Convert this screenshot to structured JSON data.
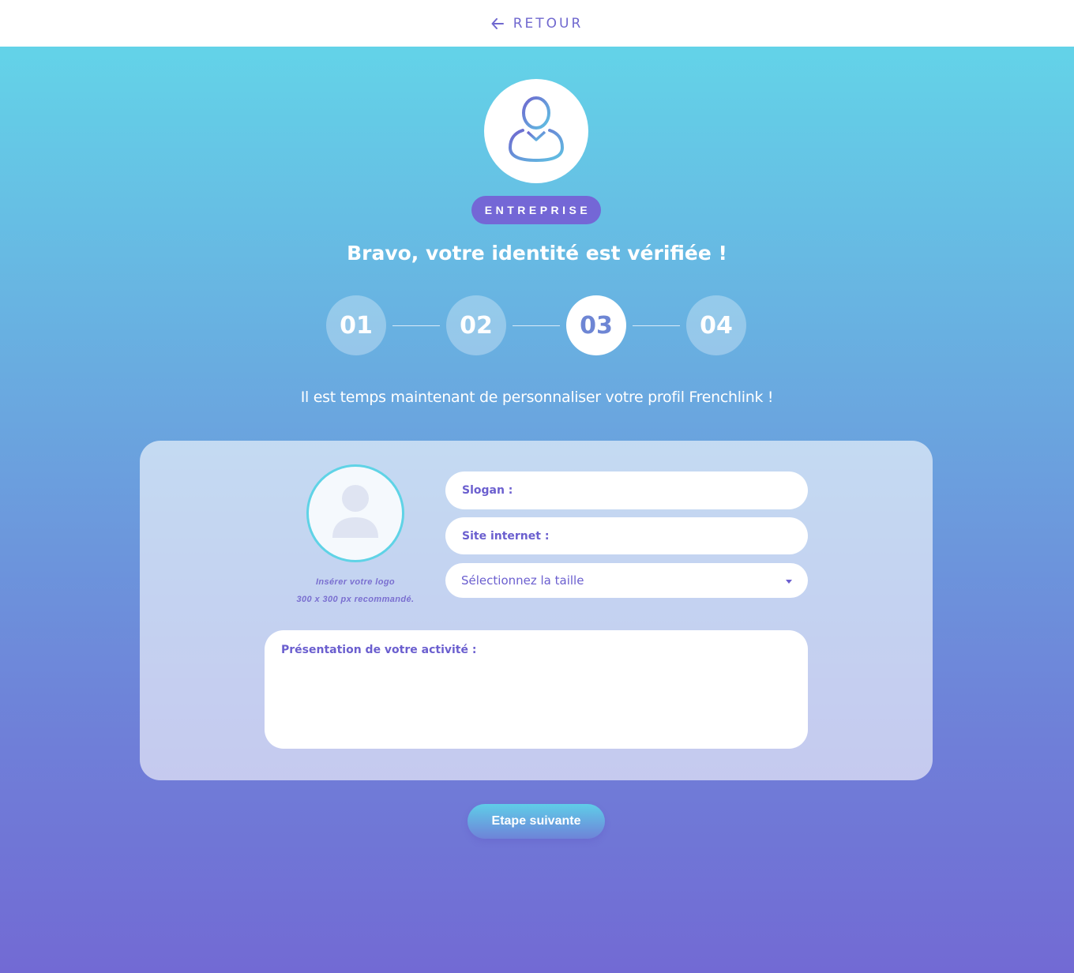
{
  "header": {
    "back_label": "RETOUR",
    "back_icon": "arrow-left-icon"
  },
  "profile": {
    "avatar_icon": "user-tie-icon",
    "badge": "ENTREPRISE"
  },
  "headline": "Bravo, votre identité est vérifiée !",
  "steps": {
    "items": [
      "01",
      "02",
      "03",
      "04"
    ],
    "active_index": 2
  },
  "intro": "Il est temps maintenant de personnaliser votre profil Frenchlink !",
  "form": {
    "logo_upload": {
      "icon": "user-placeholder-icon",
      "hint_line1": "Insérer votre logo",
      "hint_line2": "300 x 300 px recommandé."
    },
    "slogan_placeholder": "Slogan :",
    "website_placeholder": "Site internet :",
    "size_select": {
      "selected": "Sélectionnez la taille",
      "icon": "caret-down-icon"
    },
    "presentation_placeholder": "Présentation de votre activité :"
  },
  "next_button": "Etape suivante",
  "colors": {
    "accent": "#7467d6",
    "gradient_top": "#63d3e8",
    "gradient_bottom": "#726ad4",
    "label": "#6b5fcf"
  }
}
